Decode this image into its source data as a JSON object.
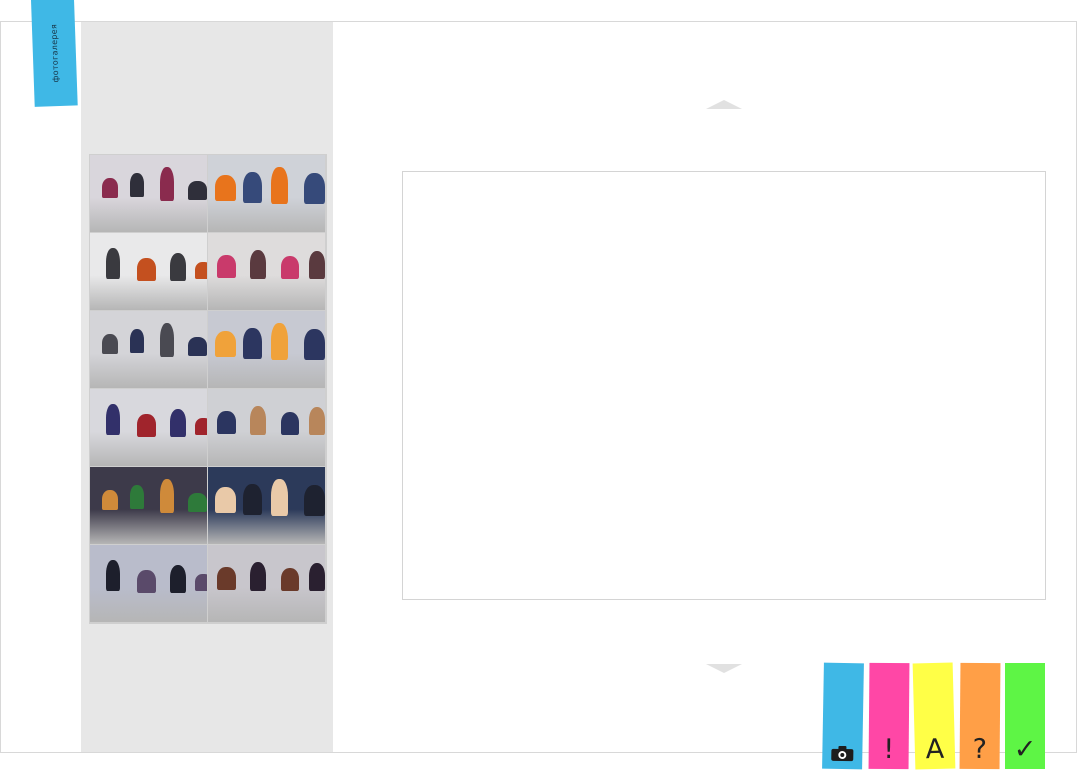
{
  "bookmark": {
    "label": "фотогалерея",
    "color": "#3fb8e6"
  },
  "gallery": {
    "thumbnails": [
      {
        "bg": "#d9d6dc",
        "accent": "#8a2b4e",
        "accent2": "#2f2f3a"
      },
      {
        "bg": "#cfd2d8",
        "accent": "#e8741c",
        "accent2": "#364a7a"
      },
      {
        "bg": "#e9e9ea",
        "accent": "#3a3a3f",
        "accent2": "#c4501f"
      },
      {
        "bg": "#dedcdc",
        "accent": "#5a3a3f",
        "accent2": "#c93a6b"
      },
      {
        "bg": "#d4d4d8",
        "accent": "#4a4a52",
        "accent2": "#2a3255"
      },
      {
        "bg": "#c7c9d2",
        "accent": "#f0a23a",
        "accent2": "#2c3660"
      },
      {
        "bg": "#d8d8dd",
        "accent": "#32306a",
        "accent2": "#a0242c"
      },
      {
        "bg": "#cfd0d4",
        "accent": "#b8865b",
        "accent2": "#2b3560"
      },
      {
        "bg": "#3d3a4a",
        "accent": "#cf8a3a",
        "accent2": "#2e7a3a"
      },
      {
        "bg": "#2c3a5a",
        "accent": "#e9c9a8",
        "accent2": "#1e2230"
      },
      {
        "bg": "#b9bccb",
        "accent": "#1d1f2c",
        "accent2": "#5a4a6a"
      },
      {
        "bg": "#c8c6cc",
        "accent": "#2a2030",
        "accent2": "#6a3a2a"
      }
    ]
  },
  "viewer": {
    "up_arrow": "",
    "down_arrow": ""
  },
  "tabs": [
    {
      "name": "photo",
      "glyph": "",
      "color": "#3fb8e6",
      "icon": "camera-icon"
    },
    {
      "name": "notice",
      "glyph": "!",
      "color": "#ff47a6",
      "icon": "exclamation-icon"
    },
    {
      "name": "text",
      "glyph": "A",
      "color": "#ffff47",
      "icon": "letter-a-icon"
    },
    {
      "name": "question",
      "glyph": "?",
      "color": "#ff9f47",
      "icon": "question-icon"
    },
    {
      "name": "check",
      "glyph": "✓",
      "color": "#5ef545",
      "icon": "checkmark-icon"
    }
  ]
}
